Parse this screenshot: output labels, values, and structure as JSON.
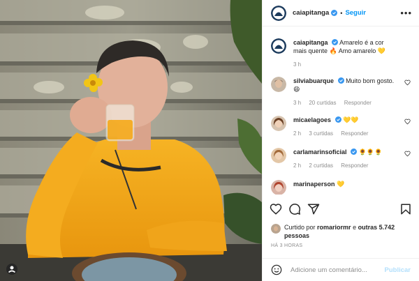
{
  "post": {
    "username": "caiapitanga",
    "follow_label": "Seguir",
    "more_label": "•••",
    "dot": "•"
  },
  "caption": {
    "username": "caiapitanga",
    "text": "Amarelo é a cor mais quente 🔥 Amo amarelo 💛",
    "time": "3 h"
  },
  "comments": [
    {
      "username": "silviabuarque",
      "text": "Muito bom gosto. 😄",
      "time": "3 h",
      "likes": "20 curtidas",
      "reply": "Responder"
    },
    {
      "username": "micaelagoes",
      "text": "💛💛",
      "time": "2 h",
      "likes": "3 curtidas",
      "reply": "Responder"
    },
    {
      "username": "carlamarinsoficial",
      "text": "🌻🌻🌻",
      "time": "2 h",
      "likes": "2 curtidas",
      "reply": "Responder"
    },
    {
      "username": "marinaperson",
      "text": "💛"
    }
  ],
  "likes": {
    "prefix": "Curtido por",
    "user": "romariormr",
    "middle": "e",
    "others": "outras 5.742 pessoas"
  },
  "timestamp": "HÁ 3 HORAS",
  "add_comment": {
    "placeholder": "Adicione um comentário...",
    "publish_label": "Publicar"
  },
  "colors": {
    "accent": "#0095f6",
    "verified": "#3897f0",
    "publish_disabled": "#b2dffc",
    "shirt": "#f2a91a"
  },
  "icons": [
    "heart-icon",
    "comment-icon",
    "share-icon",
    "bookmark-icon",
    "emoji-icon",
    "verified-icon",
    "more-icon"
  ]
}
